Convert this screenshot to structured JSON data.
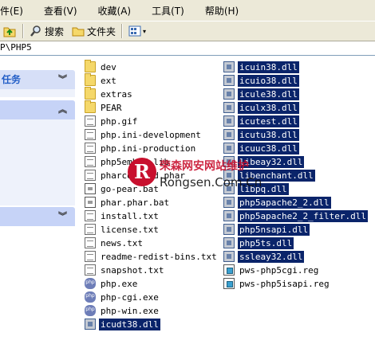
{
  "menubar": {
    "items": [
      "件(E)",
      "查看(V)",
      "收藏(A)",
      "工具(T)",
      "帮助(H)"
    ]
  },
  "toolbar": {
    "search_label": "搜索",
    "folders_label": "文件夹"
  },
  "address": {
    "value": "P\\PHP5"
  },
  "left_pane": {
    "task_header": "任务",
    "header2": "",
    "header3": ""
  },
  "files_col1": [
    {
      "name": "dev",
      "icon": "folder-icon",
      "selected": false
    },
    {
      "name": "ext",
      "icon": "folder-icon",
      "selected": false
    },
    {
      "name": "extras",
      "icon": "folder-icon",
      "selected": false
    },
    {
      "name": "PEAR",
      "icon": "folder-icon",
      "selected": false
    },
    {
      "name": "php.gif",
      "icon": "image-file-icon",
      "selected": false
    },
    {
      "name": "php.ini-development",
      "icon": "text-file-icon",
      "selected": false
    },
    {
      "name": "php.ini-production",
      "icon": "text-file-icon",
      "selected": false
    },
    {
      "name": "php5embed.lib",
      "icon": "file-icon",
      "selected": false
    },
    {
      "name": "pharcommand.phar",
      "icon": "file-icon",
      "selected": false
    },
    {
      "name": "go-pear.bat",
      "icon": "batch-file-icon",
      "selected": false
    },
    {
      "name": "phar.phar.bat",
      "icon": "batch-file-icon",
      "selected": false
    },
    {
      "name": "install.txt",
      "icon": "text-file-icon",
      "selected": false
    },
    {
      "name": "license.txt",
      "icon": "text-file-icon",
      "selected": false
    },
    {
      "name": "news.txt",
      "icon": "text-file-icon",
      "selected": false
    },
    {
      "name": "readme-redist-bins.txt",
      "icon": "text-file-icon",
      "selected": false
    },
    {
      "name": "snapshot.txt",
      "icon": "text-file-icon",
      "selected": false
    },
    {
      "name": "php.exe",
      "icon": "php-exe-icon",
      "selected": false
    },
    {
      "name": "php-cgi.exe",
      "icon": "php-exe-icon",
      "selected": false
    },
    {
      "name": "php-win.exe",
      "icon": "php-exe-icon",
      "selected": false
    },
    {
      "name": "icudt38.dll",
      "icon": "dll-icon",
      "selected": true
    }
  ],
  "files_col2": [
    {
      "name": "icuin38.dll",
      "icon": "dll-icon",
      "selected": true
    },
    {
      "name": "icuio38.dll",
      "icon": "dll-icon",
      "selected": true
    },
    {
      "name": "icule38.dll",
      "icon": "dll-icon",
      "selected": true
    },
    {
      "name": "iculx38.dll",
      "icon": "dll-icon",
      "selected": true
    },
    {
      "name": "icutest.dll",
      "icon": "dll-icon",
      "selected": true
    },
    {
      "name": "icutu38.dll",
      "icon": "dll-icon",
      "selected": true
    },
    {
      "name": "icuuc38.dll",
      "icon": "dll-icon",
      "selected": true
    },
    {
      "name": "libeay32.dll",
      "icon": "dll-icon",
      "selected": true
    },
    {
      "name": "libenchant.dll",
      "icon": "dll-icon",
      "selected": true
    },
    {
      "name": "libpq.dll",
      "icon": "dll-icon",
      "selected": true
    },
    {
      "name": "php5apache2_2.dll",
      "icon": "dll-icon",
      "selected": true
    },
    {
      "name": "php5apache2_2_filter.dll",
      "icon": "dll-icon",
      "selected": true
    },
    {
      "name": "php5nsapi.dll",
      "icon": "dll-icon",
      "selected": true
    },
    {
      "name": "php5ts.dll",
      "icon": "dll-icon",
      "selected": true
    },
    {
      "name": "ssleay32.dll",
      "icon": "dll-icon",
      "selected": true
    },
    {
      "name": "pws-php5cgi.reg",
      "icon": "registry-file-icon",
      "selected": false
    },
    {
      "name": "pws-php5isapi.reg",
      "icon": "registry-file-icon",
      "selected": false
    }
  ],
  "watermark": {
    "logo_letter": "R",
    "cn_text": "荣森网安网站维护",
    "en_text": "Rongsen.Com.Cn"
  },
  "colors": {
    "selection_bg": "#0a246a",
    "toolbar_bg": "#ece9d8",
    "task_header_text": "#215dc6"
  }
}
